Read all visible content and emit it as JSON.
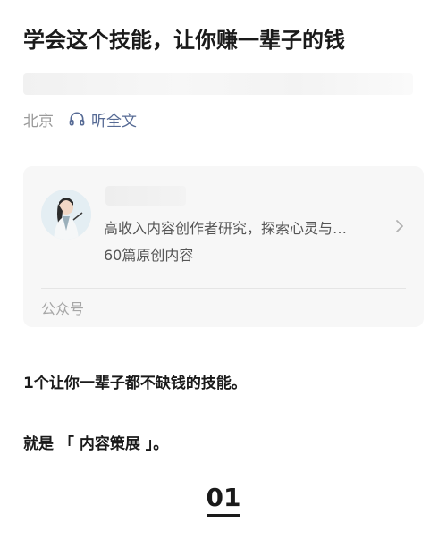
{
  "article": {
    "title": "学会这个技能，让你赚一辈子的钱",
    "location": "北京",
    "listen_label": "听全文"
  },
  "account_card": {
    "description": "高收入内容创作者研究，探索心灵与…",
    "article_count": "60篇原创内容",
    "type_label": "公众号"
  },
  "content": {
    "paragraph1": "1个让你一辈子都不缺钱的技能。",
    "paragraph2": "就是 「 内容策展 」。",
    "section_number": "01"
  },
  "colors": {
    "link": "#576b95",
    "muted": "#9a9a9a",
    "card_bg": "#f7f7f7"
  }
}
